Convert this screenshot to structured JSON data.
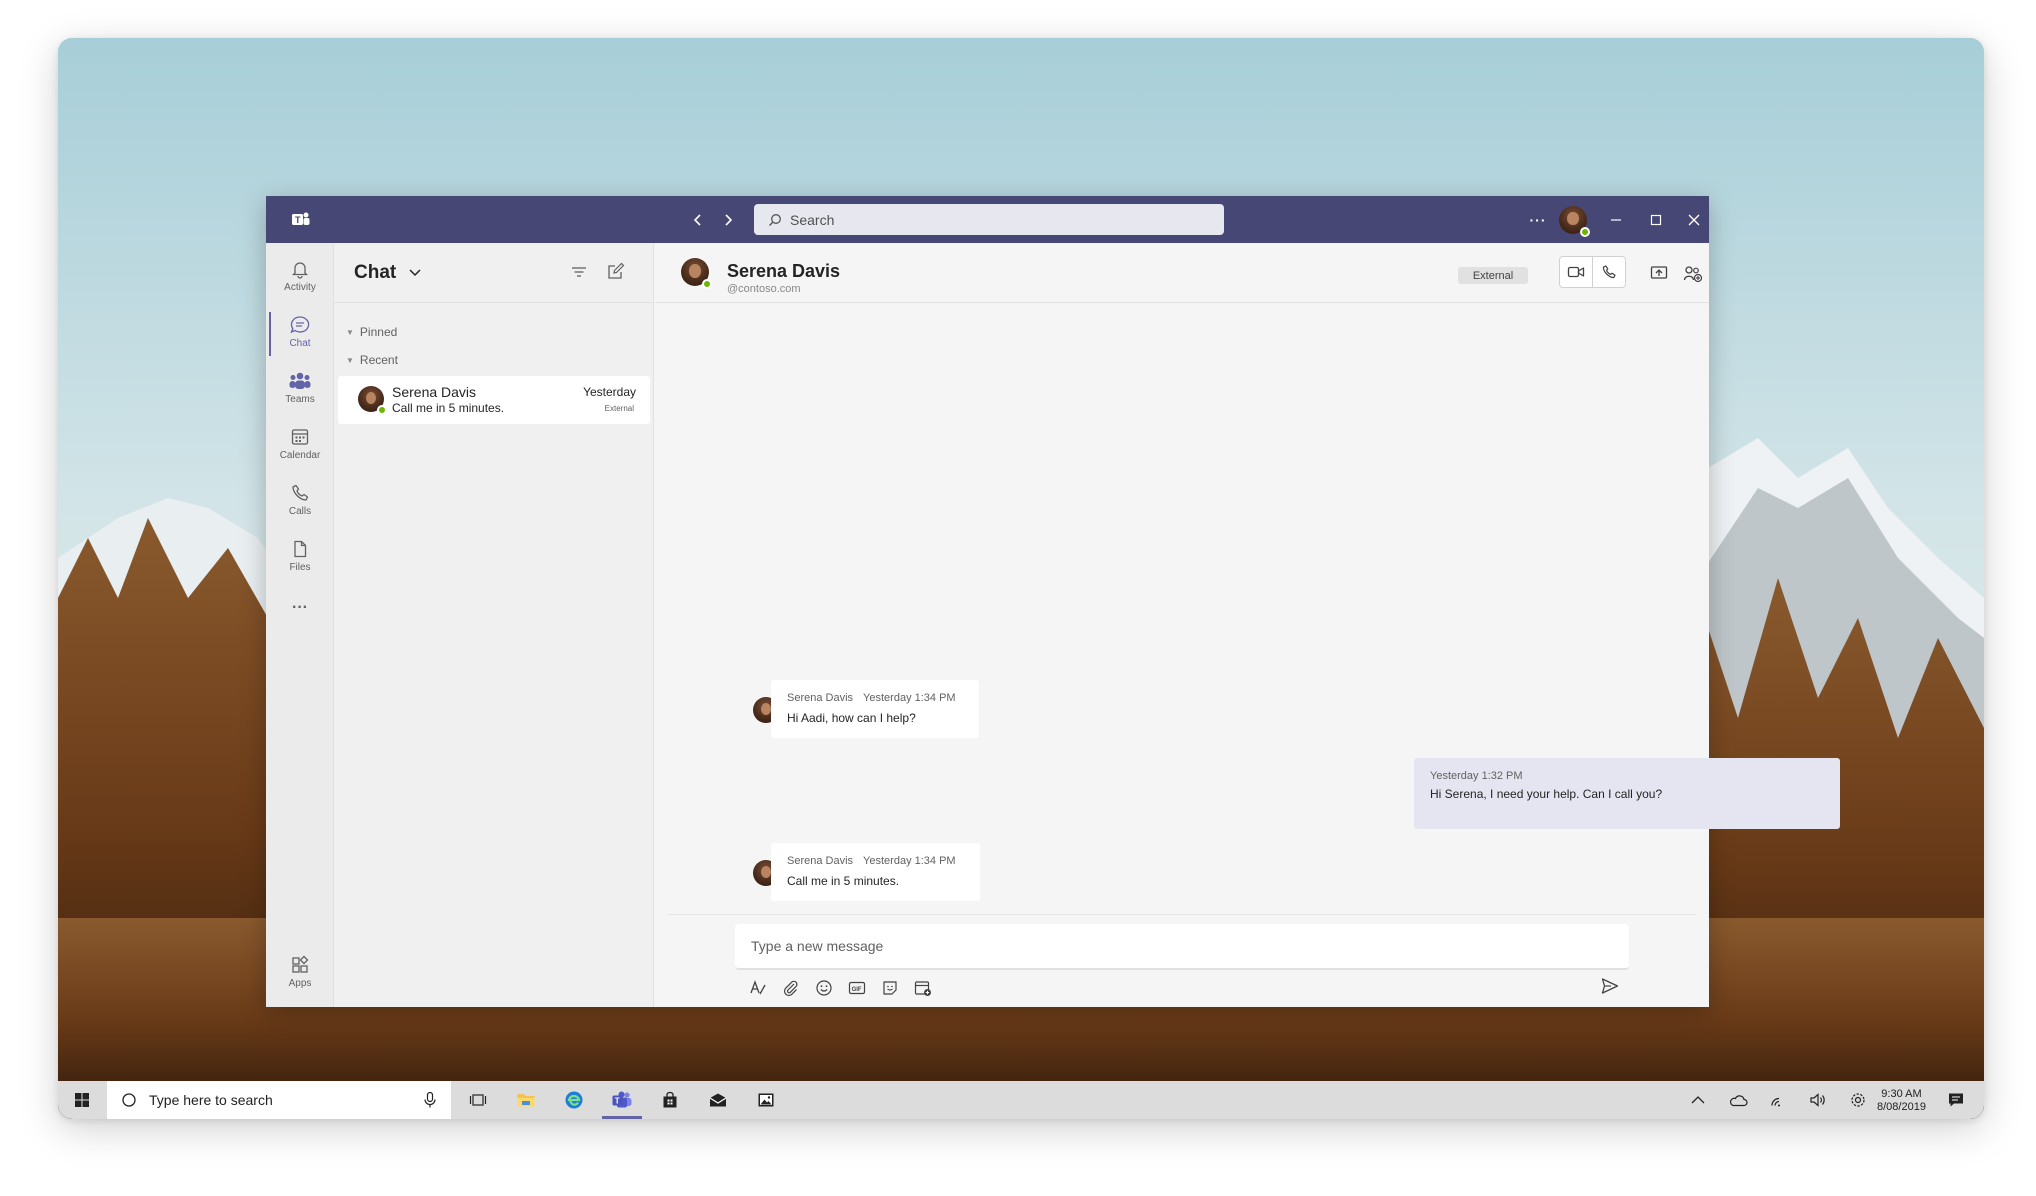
{
  "titlebar": {
    "search_placeholder": "Search",
    "more_label": "···"
  },
  "rail": {
    "items": [
      {
        "label": "Activity",
        "icon": "bell-icon"
      },
      {
        "label": "Chat",
        "icon": "chat-icon",
        "active": true
      },
      {
        "label": "Teams",
        "icon": "teams-icon"
      },
      {
        "label": "Calendar",
        "icon": "calendar-icon"
      },
      {
        "label": "Calls",
        "icon": "phone-icon"
      },
      {
        "label": "Files",
        "icon": "file-icon"
      }
    ],
    "more_label": "···",
    "apps_label": "Apps"
  },
  "chatlist": {
    "title": "Chat",
    "sections": {
      "pinned": "Pinned",
      "recent": "Recent"
    },
    "items": [
      {
        "name": "Serena Davis",
        "preview": "Call me in 5 minutes.",
        "time": "Yesterday",
        "tag": "External"
      }
    ]
  },
  "conversation": {
    "contact_name": "Serena Davis",
    "contact_domain": "@contoso.com",
    "badge": "External",
    "messages": [
      {
        "sender": "Serena Davis",
        "time": "Yesterday  1:34 PM",
        "text": "Hi Aadi, how can I help?",
        "self": false
      },
      {
        "sender": "",
        "time": "Yesterday  1:32 PM",
        "text": "Hi Serena, I need your help. Can I call you?",
        "self": true
      },
      {
        "sender": "Serena Davis",
        "time": "Yesterday  1:34 PM",
        "text": "Call me in 5 minutes.",
        "self": false
      }
    ],
    "composer_placeholder": "Type a new message"
  },
  "taskbar": {
    "search_placeholder": "Type here to search",
    "clock_time": "9:30 AM",
    "clock_date": "8/08/2019"
  },
  "colors": {
    "brand": "#464775",
    "accent": "#6264a7",
    "presence": "#6bb700",
    "self_bubble": "#e5e5f1"
  }
}
